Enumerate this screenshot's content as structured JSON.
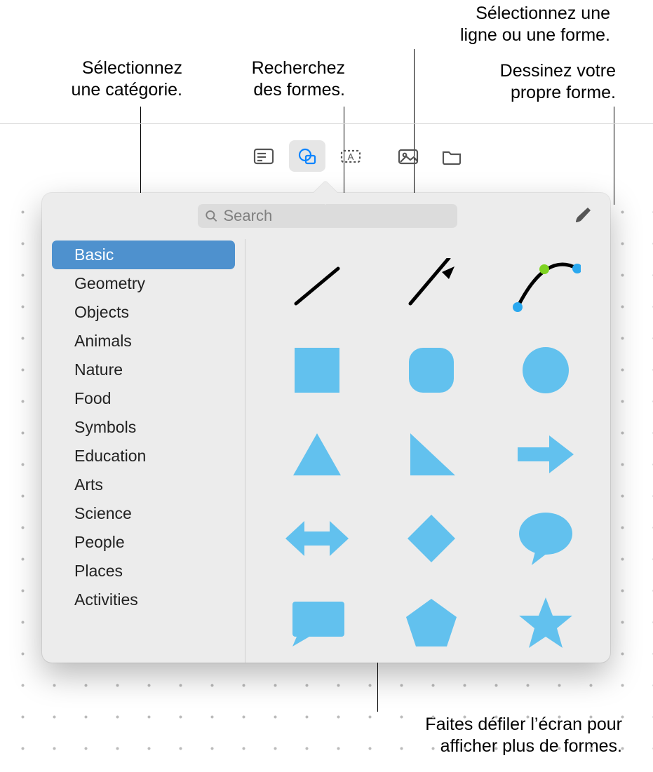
{
  "callouts": {
    "category": "Sélectionnez\nune catégorie.",
    "search": "Recherchez\ndes formes.",
    "select_shape": "Sélectionnez une\nligne ou une forme.",
    "draw": "Dessinez votre\npropre forme.",
    "scroll": "Faites défiler l’écran pour\nafficher plus de formes."
  },
  "search": {
    "placeholder": "Search"
  },
  "sidebar": {
    "items": [
      "Basic",
      "Geometry",
      "Objects",
      "Animals",
      "Nature",
      "Food",
      "Symbols",
      "Education",
      "Arts",
      "Science",
      "People",
      "Places",
      "Activities"
    ],
    "selected_index": 0
  },
  "shapes": [
    "line",
    "arrow-line",
    "curve-editable",
    "square",
    "rounded-square",
    "circle",
    "triangle",
    "right-triangle",
    "arrow-right",
    "arrow-both",
    "diamond",
    "speech-bubble",
    "callout-box",
    "pentagon",
    "star"
  ],
  "toolbar": {
    "buttons": [
      "slide-layout",
      "shapes",
      "text-box",
      "media",
      "folder"
    ],
    "active_index": 1
  }
}
